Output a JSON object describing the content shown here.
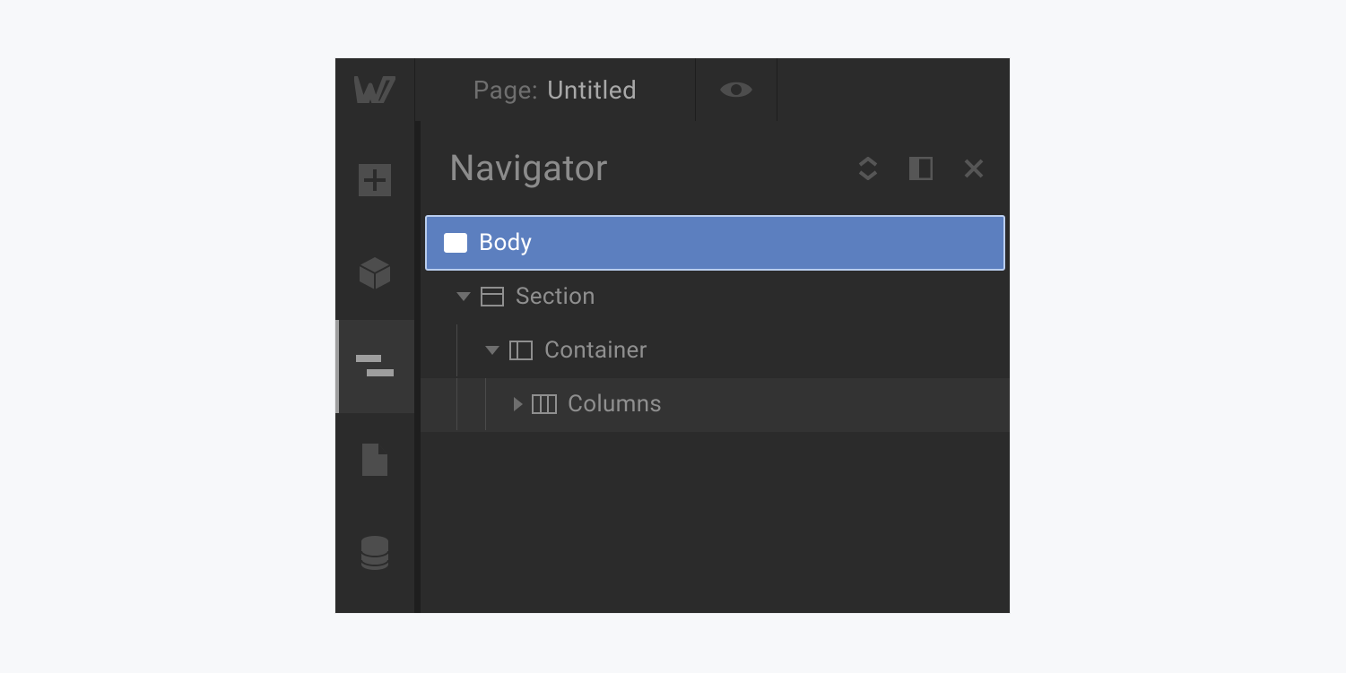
{
  "topbar": {
    "page_prefix": "Page:",
    "page_name": "Untitled"
  },
  "panel": {
    "title": "Navigator"
  },
  "tree": {
    "body": {
      "label": "Body"
    },
    "section": {
      "label": "Section"
    },
    "container": {
      "label": "Container"
    },
    "columns": {
      "label": "Columns"
    }
  }
}
